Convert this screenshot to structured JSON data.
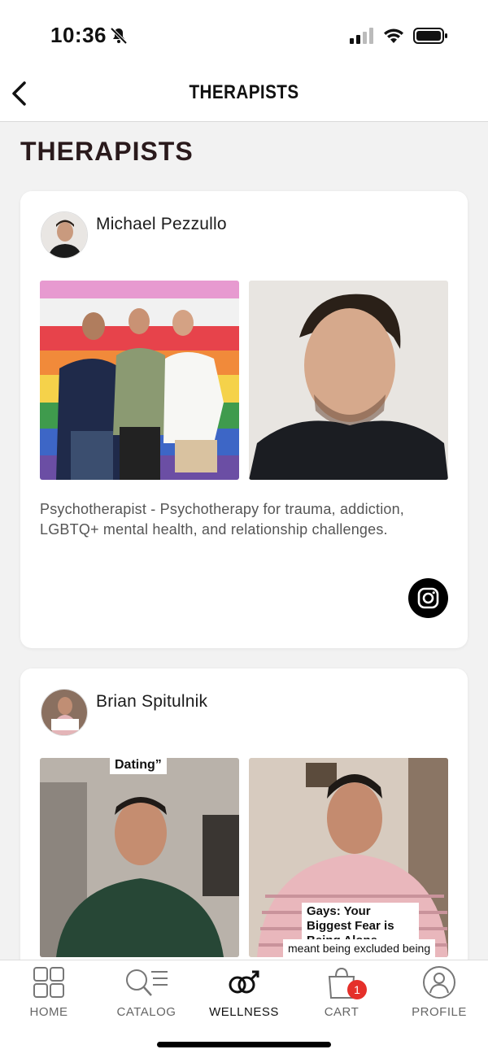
{
  "status": {
    "time": "10:36"
  },
  "nav": {
    "title": "THERAPISTS"
  },
  "page": {
    "title": "THERAPISTS"
  },
  "therapists": [
    {
      "name": "Michael Pezzullo",
      "description": "Psychotherapist - Psychotherapy for trauma, addiction, LGBTQ+ mental health, and relationship challenges."
    },
    {
      "name": "Brian Spitulnik",
      "photo_captions": [
        "Dating”",
        "Gays: Your Biggest Fear is Being Alone",
        "meant being excluded being"
      ],
      "avatar_caption": "Gays: Your Biggest Fear is Being Alone"
    }
  ],
  "tabbar": {
    "tabs": [
      {
        "label": "HOME",
        "icon": "home-grid-icon"
      },
      {
        "label": "CATALOG",
        "icon": "catalog-search-icon"
      },
      {
        "label": "WELLNESS",
        "icon": "wellness-gender-icon",
        "active": true
      },
      {
        "label": "CART",
        "icon": "cart-bag-icon",
        "badge": "1"
      },
      {
        "label": "PROFILE",
        "icon": "profile-person-icon"
      }
    ]
  },
  "colors": {
    "accent": "#2a1a1c",
    "badge": "#e5302a",
    "background": "#f2f2f2"
  }
}
